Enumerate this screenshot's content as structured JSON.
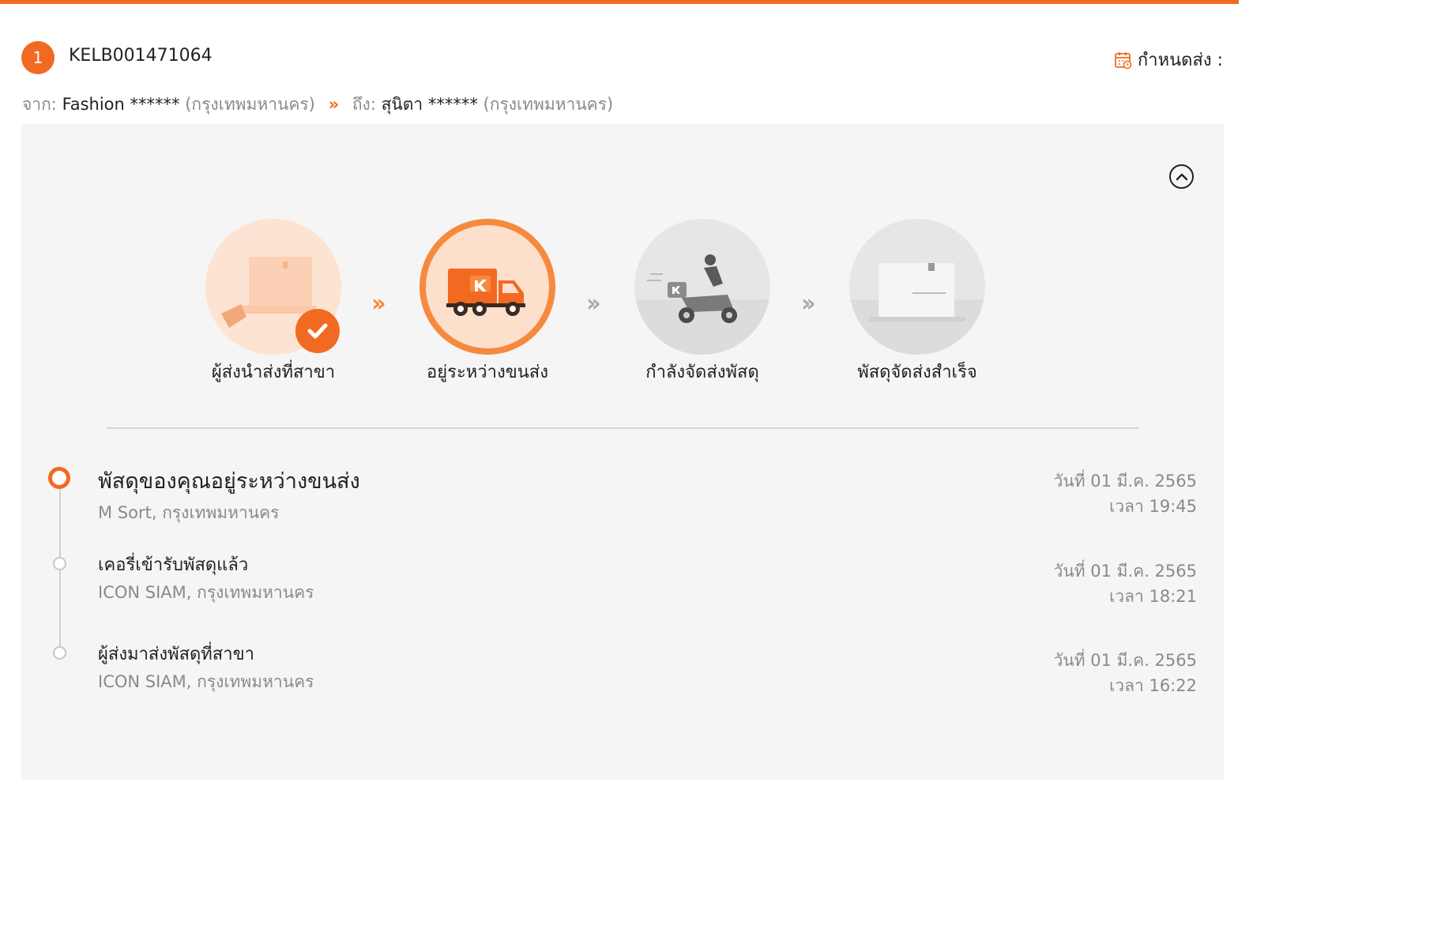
{
  "order": {
    "index": "1",
    "tracking_number": "KELB001471064"
  },
  "delivery_due": {
    "label": "กำหนดส่ง :"
  },
  "route": {
    "from_label": "จาก:",
    "from_name": "Fashion ******",
    "from_city": "(กรุงเทพมหานคร)",
    "to_label": "ถึง:",
    "to_name": "สุนิตา ******",
    "to_city": "(กรุงเทพมหานคร)"
  },
  "steps": [
    {
      "label": "ผู้ส่งนำส่งที่สาขา",
      "status": "done"
    },
    {
      "label": "อยู่ระหว่างขนส่ง",
      "status": "current"
    },
    {
      "label": "กำลังจัดส่งพัสดุ",
      "status": "pending"
    },
    {
      "label": "พัสดุจัดส่งสำเร็จ",
      "status": "pending"
    }
  ],
  "events": [
    {
      "title": "พัสดุของคุณอยู่ระหว่างขนส่ง",
      "location": "M Sort, กรุงเทพมหานคร",
      "date": "วันที่ 01 มี.ค. 2565",
      "time": "เวลา 19:45"
    },
    {
      "title": "เคอรี่เข้ารับพัสดุแล้ว",
      "location": "ICON SIAM, กรุงเทพมหานคร",
      "date": "วันที่ 01 มี.ค. 2565",
      "time": "เวลา 18:21"
    },
    {
      "title": "ผู้ส่งมาส่งพัสดุที่สาขา",
      "location": "ICON SIAM, กรุงเทพมหานคร",
      "date": "วันที่ 01 มี.ค. 2565",
      "time": "เวลา 16:22"
    }
  ],
  "icons": {
    "calendar": "calendar-icon",
    "collapse": "chevron-up-icon",
    "step_arrow": "double-chevron-right-icon",
    "check": "check-icon"
  },
  "colors": {
    "accent": "#f26a21",
    "panel": "#f5f5f5",
    "muted": "#8a8a8a"
  }
}
